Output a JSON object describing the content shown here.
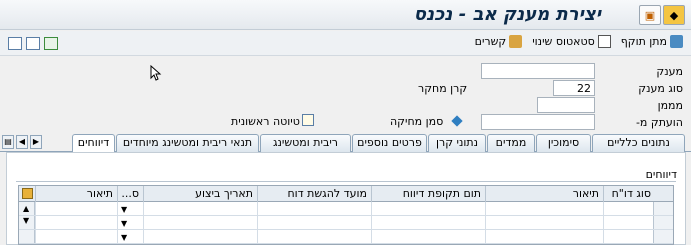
{
  "title": "יצירת מענק אב - נכנס",
  "toolbar": {
    "items": [
      "מתן תוקף",
      "סטאטוס שינוי",
      "קשרים"
    ]
  },
  "form": {
    "grant_label": "מענק",
    "grant_value": "",
    "grant_type_label": "סוג מענק",
    "grant_type_value": "22",
    "fund_research_label": "קרן מחקר",
    "sponsor_label": "מממן",
    "sponsor_value": "",
    "copied_from_label": "הועתק מ-",
    "copied_from_value": "",
    "delete_mark_label": "סמן מחיקה",
    "first_draft_label": "טיוטה ראשונית"
  },
  "tabs": [
    "נתונים כלליים",
    "סימוכין",
    "ממדים",
    "נתוני קרן",
    "פרטים נוספים",
    "ריבית ומטשינג",
    "תנאי ריבית ומטשינג מיוחדים",
    "דיווחים"
  ],
  "active_tab": "דיווחים",
  "reports": {
    "group_title": "דיווחים",
    "columns": [
      "סוג דו\"ח",
      "תיאור",
      "תום תקופת דיווח",
      "מועד להגשת דוח",
      "תאריך ביצוע",
      "ס...",
      "תיאור"
    ]
  }
}
